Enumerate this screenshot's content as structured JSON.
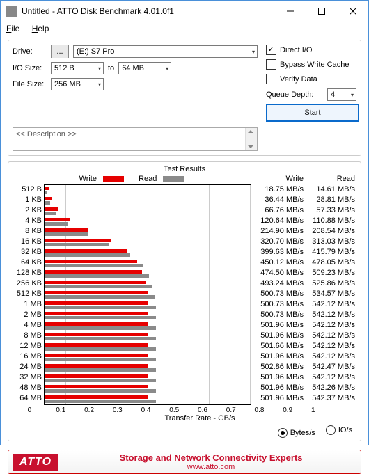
{
  "window": {
    "title": "Untitled - ATTO Disk Benchmark 4.01.0f1"
  },
  "menu": {
    "file": "File",
    "help": "Help"
  },
  "controls": {
    "drive_label": "Drive:",
    "drive_btn": "...",
    "drive_value": "(E:) S7 Pro",
    "io_label": "I/O Size:",
    "io_from": "512 B",
    "io_to_label": "to",
    "io_to": "64 MB",
    "filesize_label": "File Size:",
    "filesize_value": "256 MB",
    "direct_io": "Direct I/O",
    "bypass": "Bypass Write Cache",
    "verify": "Verify Data",
    "queue_label": "Queue Depth:",
    "queue_value": "4",
    "start": "Start",
    "description_placeholder": "<< Description >>"
  },
  "chart_data": {
    "type": "bar",
    "title": "Test Results",
    "legend": {
      "write": "Write",
      "read": "Read"
    },
    "xlabel": "Transfer Rate - GB/s",
    "xlim": [
      0,
      1
    ],
    "xticks": [
      "0",
      "0.1",
      "0.2",
      "0.3",
      "0.4",
      "0.5",
      "0.6",
      "0.7",
      "0.8",
      "0.9",
      "1"
    ],
    "unit": "MB/s",
    "categories": [
      "512 B",
      "1 KB",
      "2 KB",
      "4 KB",
      "8 KB",
      "16 KB",
      "32 KB",
      "64 KB",
      "128 KB",
      "256 KB",
      "512 KB",
      "1 MB",
      "2 MB",
      "4 MB",
      "8 MB",
      "12 MB",
      "16 MB",
      "24 MB",
      "32 MB",
      "48 MB",
      "64 MB"
    ],
    "series": [
      {
        "name": "Write",
        "values_text": [
          "18.75",
          "36.44",
          "66.76",
          "120.64",
          "214.90",
          "320.70",
          "399.63",
          "450.12",
          "474.50",
          "493.24",
          "500.73",
          "500.73",
          "500.73",
          "501.96",
          "501.96",
          "501.66",
          "501.96",
          "502.86",
          "501.96",
          "501.96",
          "501.96"
        ]
      },
      {
        "name": "Read",
        "values_text": [
          "14.61",
          "28.81",
          "57.33",
          "110.88",
          "208.54",
          "313.03",
          "415.79",
          "478.05",
          "509.23",
          "525.86",
          "534.57",
          "542.12",
          "542.12",
          "542.12",
          "542.12",
          "542.12",
          "542.12",
          "542.47",
          "542.12",
          "542.26",
          "542.37"
        ]
      }
    ],
    "max_for_scale": 1000
  },
  "radios": {
    "bytes": "Bytes/s",
    "io": "IO/s"
  },
  "footer": {
    "logo": "ATTO",
    "line1": "Storage and Network Connectivity Experts",
    "line2": "www.atto.com"
  },
  "headers": {
    "write": "Write",
    "read": "Read"
  }
}
